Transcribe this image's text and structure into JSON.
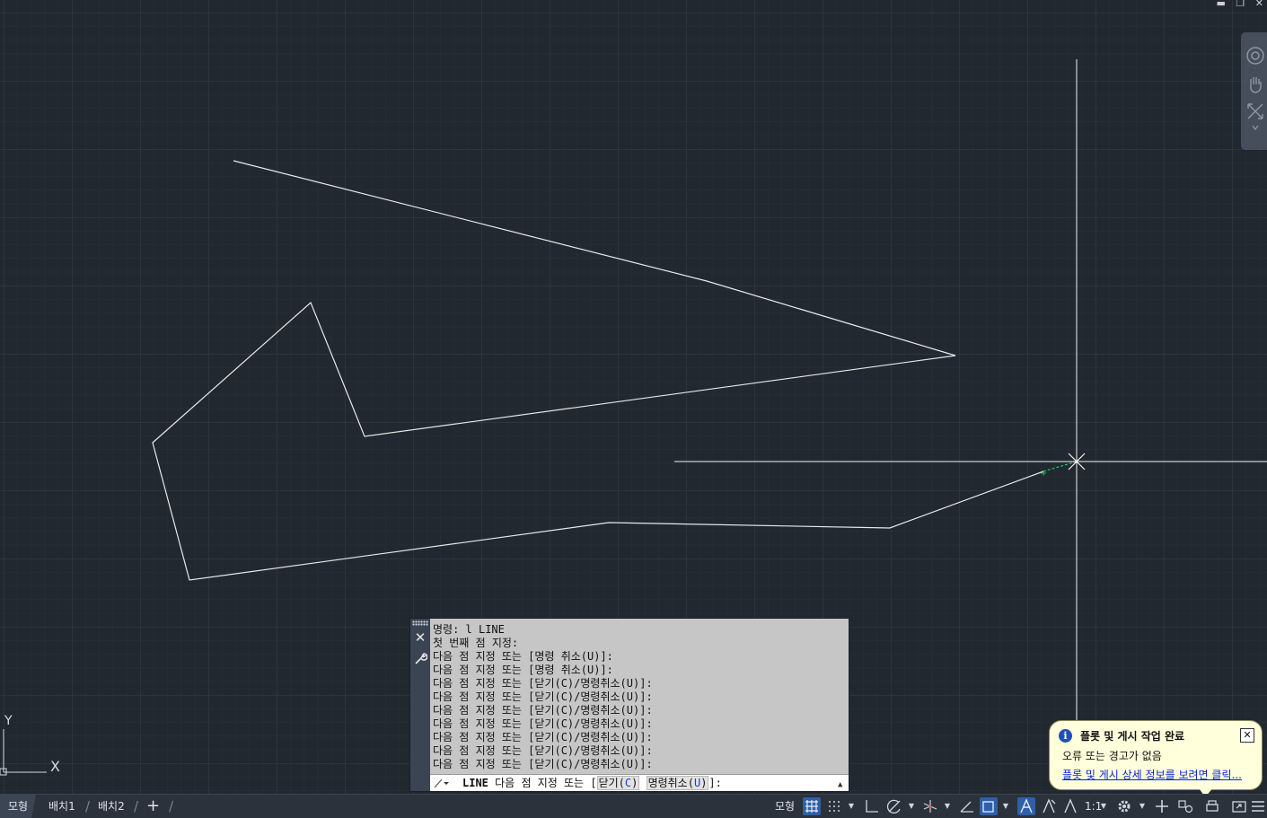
{
  "window": {
    "controls": [
      "minimize",
      "restore",
      "close"
    ]
  },
  "command_line": {
    "history": [
      "명령: l LINE",
      "첫 번째 점 지정:",
      "다음 점 지정 또는 [명령 취소(U)]:",
      "다음 점 지정 또는 [명령 취소(U)]:",
      "다음 점 지정 또는 [닫기(C)/명령취소(U)]:",
      "다음 점 지정 또는 [닫기(C)/명령취소(U)]:",
      "다음 점 지정 또는 [닫기(C)/명령취소(U)]:",
      "다음 점 지정 또는 [닫기(C)/명령취소(U)]:",
      "다음 점 지정 또는 [닫기(C)/명령취소(U)]:",
      "다음 점 지정 또는 [닫기(C)/명령취소(U)]:",
      "다음 점 지정 또는 [닫기(C)/명령취소(U)]:"
    ],
    "current_command": "LINE",
    "prompt_prefix": "다음 점 지정 또는 [",
    "option1_label": "닫기(",
    "option1_key": "C",
    "option1_suffix": ")",
    "option2_label": "명령취소(",
    "option2_key": "U",
    "option2_suffix": ")",
    "prompt_suffix": "]:"
  },
  "notification": {
    "title": "플롯 및 게시 작업 완료",
    "message": "오류 또는 경고가 없음",
    "link": "플롯 및 게시 상세 정보를 보려면 클릭..."
  },
  "ucs": {
    "y_label": "Y",
    "x_label": "X"
  },
  "statusbar": {
    "tabs": [
      "모형",
      "배치1",
      "배치2"
    ],
    "add_tab": "+",
    "model_button": "모형",
    "scale": "1:1"
  },
  "colors": {
    "background": "#212830",
    "grid_minor": "#2b323c",
    "grid_major": "#343c48",
    "geometry": "#e8e8e8",
    "active_toggle": "#2f5fa8",
    "snap_marker": "#22c55e"
  }
}
